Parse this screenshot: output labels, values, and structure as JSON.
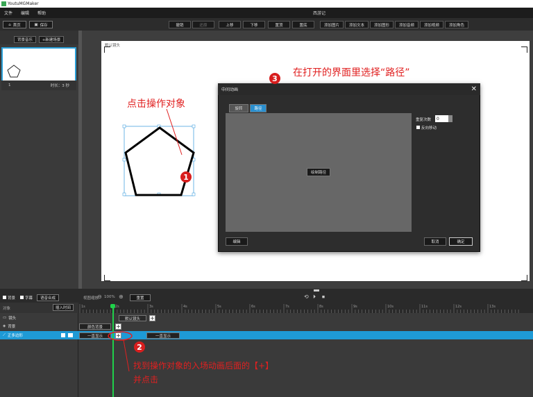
{
  "window": {
    "title": "YoutuMGMaker",
    "doc_title": "西游记"
  },
  "menu": [
    "文件",
    "编辑",
    "帮助"
  ],
  "toolbar": {
    "home": "首页",
    "save": "保存",
    "buttons": [
      "撤销",
      "还原",
      "上移",
      "下移",
      "置顶",
      "置底",
      "添加图片",
      "添加文本",
      "添加图形",
      "添加音频",
      "添加视频",
      "添加角色"
    ]
  },
  "left": {
    "bg_music": "背景音乐",
    "new_scene": "+新建场景",
    "scene_index": "1",
    "scene_duration": "时长：3 秒"
  },
  "canvas": {
    "camera_label": "默认镜头"
  },
  "dialog": {
    "title": "中间动画",
    "tabs": [
      "旋转",
      "路径"
    ],
    "draw_path": "绘制路径",
    "repeat_label": "重复次数",
    "repeat_value": "0",
    "checkbox_label": "反向移动",
    "edit": "编辑",
    "cancel": "取消",
    "ok": "确定"
  },
  "timeline": {
    "toolbar": {
      "bg": "背景",
      "subtitle": "字幕",
      "voice": "语音合成",
      "zoom_label": "视图缩放",
      "zoom_value": "100%",
      "reset": "重置"
    },
    "header": {
      "object": "对象",
      "insert_time": "插入时间"
    },
    "ruler_ticks": [
      "1s",
      "2s",
      "3s",
      "4s",
      "5s",
      "6s",
      "7s",
      "8s",
      "9s",
      "10s",
      "11s",
      "12s",
      "13s"
    ],
    "rows": {
      "camera": {
        "label": "镜头",
        "clip": "默认镜头"
      },
      "bg": {
        "label": "背景",
        "clip": "颜色背景"
      },
      "object": {
        "label": "正多边形",
        "clip_in": "一直显示",
        "clip_out": "一直显示"
      }
    }
  },
  "annotations": {
    "a1": "点击操作对象",
    "a2_line1": "找到操作对象的入场动画后面的【+】",
    "a2_line2": "并点击",
    "a3": "在打开的界面里选择“路径”",
    "n1": "1",
    "n2": "2",
    "n3": "3"
  }
}
